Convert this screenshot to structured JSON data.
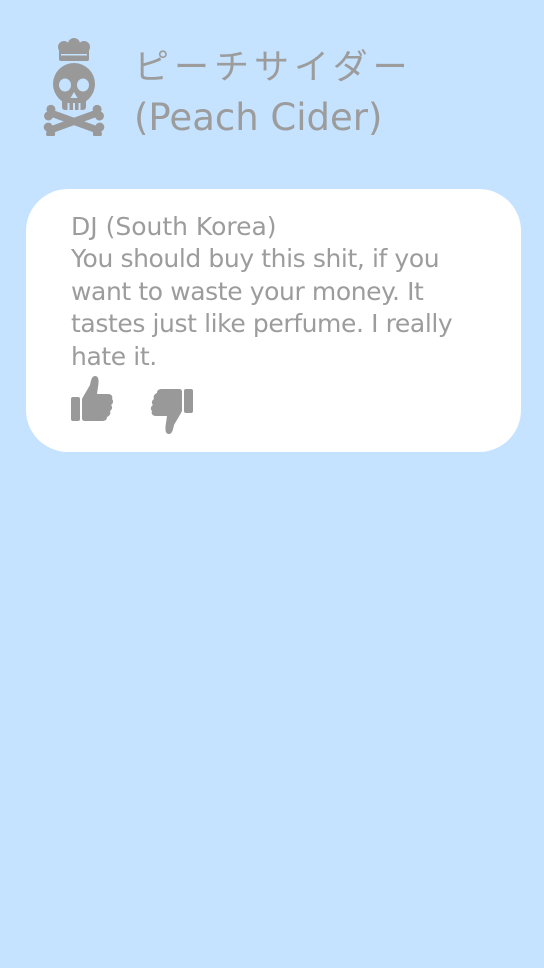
{
  "header": {
    "logo_icon": "chef-skull-crossbones-icon",
    "title_japanese": "ピーチサイダー",
    "title_english": "(Peach Cider)"
  },
  "review": {
    "reviewer": "DJ (South Korea)",
    "text": "You should buy this shit, if you want to waste your money. It tastes just like perfume. I really hate it.",
    "thumbs_up_icon": "thumbs-up-icon",
    "thumbs_down_icon": "thumbs-down-icon"
  },
  "colors": {
    "background": "#c5e2ff",
    "card": "#ffffff",
    "text": "#9c9c9c",
    "icon": "#999999"
  }
}
